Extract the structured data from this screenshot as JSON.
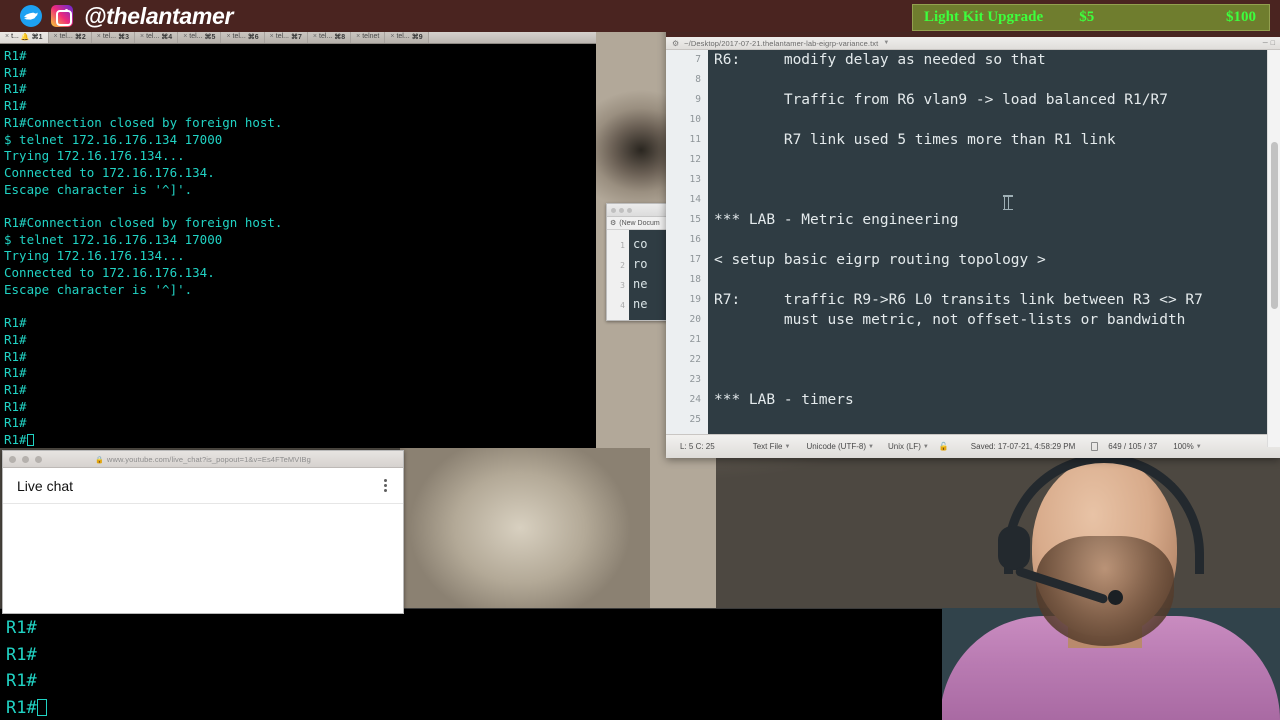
{
  "brand": {
    "handle": "@thelantamer",
    "twitter_icon": "twitter-bird-icon",
    "instagram_icon": "instagram-camera-icon",
    "bar_color": "#4a2420"
  },
  "upgrade_banner": {
    "label": "Light Kit Upgrade",
    "current": "$5",
    "goal": "$100",
    "bg_color": "#6f7d2e",
    "text_color": "#3dff3d"
  },
  "terminal_tabs": [
    {
      "label": "t...",
      "shortcut": "⌘1",
      "bell": true,
      "active": true
    },
    {
      "label": "tel...",
      "shortcut": "⌘2",
      "bell": false,
      "active": false
    },
    {
      "label": "tel...",
      "shortcut": "⌘3",
      "bell": false,
      "active": false
    },
    {
      "label": "tel...",
      "shortcut": "⌘4",
      "bell": false,
      "active": false
    },
    {
      "label": "tel...",
      "shortcut": "⌘5",
      "bell": false,
      "active": false
    },
    {
      "label": "tel...",
      "shortcut": "⌘6",
      "bell": false,
      "active": false
    },
    {
      "label": "tel...",
      "shortcut": "⌘7",
      "bell": false,
      "active": false
    },
    {
      "label": "tel...",
      "shortcut": "⌘8",
      "bell": false,
      "active": false
    },
    {
      "label": "telnet",
      "shortcut": "",
      "bell": false,
      "active": false
    },
    {
      "label": "tel...",
      "shortcut": "⌘9",
      "bell": false,
      "active": false
    }
  ],
  "terminal_main": {
    "lines": [
      "R1#",
      "R1#",
      "R1#",
      "R1#",
      "R1#Connection closed by foreign host.",
      "$ telnet 172.16.176.134 17000",
      "Trying 172.16.176.134...",
      "Connected to 172.16.176.134.",
      "Escape character is '^]'.",
      "",
      "R1#Connection closed by foreign host.",
      "$ telnet 172.16.176.134 17000",
      "Trying 172.16.176.134...",
      "Connected to 172.16.176.134.",
      "Escape character is '^]'.",
      "",
      "R1#",
      "R1#",
      "R1#",
      "R1#",
      "R1#",
      "R1#",
      "R1#",
      "R1#"
    ],
    "prompt_color": "#21d3c4",
    "bg_color": "#000000"
  },
  "terminal_bottom": {
    "lines": [
      "R1#",
      "R1#",
      "R1#",
      "R1#"
    ],
    "prompt_color": "#21d3c4"
  },
  "live_chat": {
    "url": "www.youtube.com/live_chat?is_popout=1&v=Es4FTeMVIBg",
    "lock_icon": "lock-icon",
    "title": "Live chat",
    "menu_icon": "kebab-menu-icon",
    "messages": []
  },
  "mini_editor": {
    "tab_title": "(New Docum",
    "gear_icon": "gear-icon",
    "line_numbers": [
      "1",
      "2",
      "3",
      "4"
    ],
    "lines": [
      "co",
      "ro",
      "ne",
      "ne"
    ]
  },
  "editor": {
    "gear_icon": "gear-icon",
    "filename": "~/Desktop/2017-07-21.thelantamer-lab-eigrp-variance.txt",
    "caret_icon": "chevron-down-icon",
    "window_buttons": [
      "minimize-icon",
      "maximize-icon"
    ],
    "line_numbers": [
      "7",
      "8",
      "9",
      "10",
      "11",
      "12",
      "13",
      "14",
      "15",
      "16",
      "17",
      "18",
      "19",
      "20",
      "21",
      "22",
      "23",
      "24",
      "25"
    ],
    "lines": [
      "R6:     modify delay as needed so that",
      "",
      "        Traffic from R6 vlan9 -> load balanced R1/R7",
      "",
      "        R7 link used 5 times more than R1 link",
      "",
      "",
      "",
      "*** LAB - Metric engineering",
      "",
      "< setup basic eigrp routing topology >",
      "",
      "R7:     traffic R9->R6 L0 transits link between R3 <> R7",
      "        must use metric, not offset-lists or bandwidth",
      "",
      "",
      "",
      "*** LAB - timers",
      ""
    ],
    "bg_color": "#2f3c43",
    "text_color": "#e4eaec",
    "status": {
      "cursor_pos": "L: 5 C: 25",
      "file_type": "Text File",
      "encoding": "Unicode (UTF-8)",
      "line_ending": "Unix (LF)",
      "lock_icon": "unlocked-padlock-icon",
      "saved": "Saved: 17-07-21, 4:58:29 PM",
      "doc_icon": "document-icon",
      "counts": "649 / 105 / 37",
      "zoom": "100%"
    }
  },
  "webcam": {
    "description": "streamer-webcam-overlay"
  }
}
